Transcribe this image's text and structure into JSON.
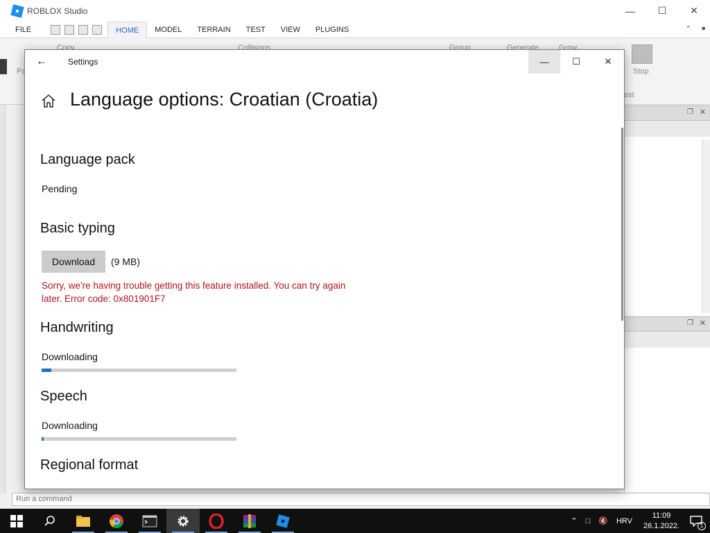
{
  "studio": {
    "title": "ROBLOX Studio",
    "menu_file": "FILE",
    "tabs": [
      "HOME",
      "MODEL",
      "TERRAIN",
      "TEST",
      "VIEW",
      "PLUGINS"
    ],
    "active_tab": "HOME",
    "ribbon": {
      "copy": "Copy",
      "collisions": "Collisions",
      "group": "Group",
      "generate": "Generate",
      "grow": "Grow",
      "pa": "Pa",
      "stop": "Stop",
      "est": "est"
    },
    "command_placeholder": "Run a command"
  },
  "settings": {
    "window_title": "Settings",
    "heading": "Language options: Croatian (Croatia)",
    "language_pack": {
      "title": "Language pack",
      "status": "Pending"
    },
    "basic_typing": {
      "title": "Basic typing",
      "button": "Download",
      "size": "(9 MB)",
      "error": "Sorry, we're having trouble getting this feature installed. You can try again later. Error code: 0x801901F7"
    },
    "handwriting": {
      "title": "Handwriting",
      "status": "Downloading",
      "progress": 0.05
    },
    "speech": {
      "title": "Speech",
      "status": "Downloading",
      "progress": 0.01
    },
    "regional_format": {
      "title": "Regional format"
    }
  },
  "taskbar": {
    "language": "HRV",
    "time": "11:09",
    "date": "26.1.2022.",
    "notification_count": "1"
  },
  "colors": {
    "accent": "#1f6fc0",
    "error": "#b0141d"
  }
}
